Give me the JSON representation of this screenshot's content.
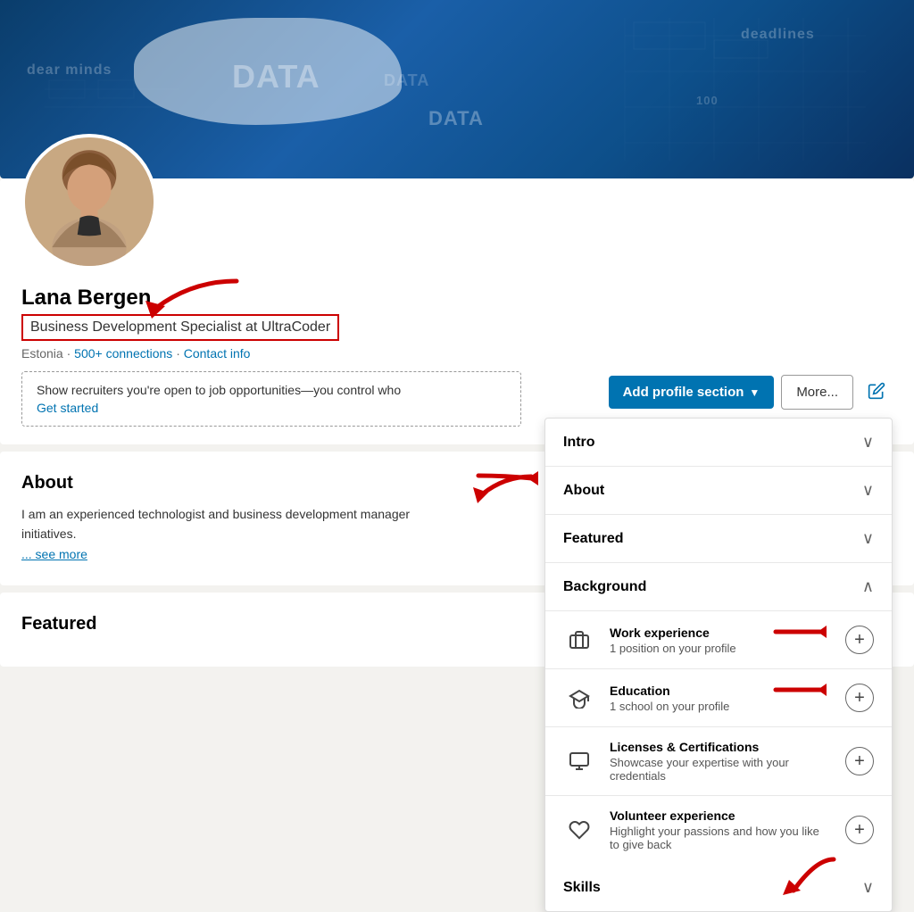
{
  "profile": {
    "name": "Lana Bergen",
    "title": "Business Development Specialist at UltraCoder",
    "location": "Estonia",
    "connections": "500+ connections",
    "contact_info": "Contact info",
    "open_to_work_text": "Show recruiters you're open to job opportunities—you control who",
    "get_started": "Get started",
    "about_heading": "About",
    "about_text": "I am an experienced technologist and business development manager",
    "about_text2": "initiatives.",
    "see_more": "... see more",
    "featured_heading": "Featured"
  },
  "toolbar": {
    "add_section_label": "Add profile section",
    "more_label": "More...",
    "edit_icon": "pencil"
  },
  "dropdown": {
    "intro_label": "Intro",
    "about_label": "About",
    "featured_label": "Featured",
    "background_label": "Background",
    "background_items": [
      {
        "icon": "briefcase",
        "title": "Work experience",
        "subtitle": "1 position on your profile"
      },
      {
        "icon": "school",
        "title": "Education",
        "subtitle": "1 school on your profile"
      },
      {
        "icon": "certificate",
        "title": "Licenses & Certifications",
        "subtitle": "Showcase your expertise with your credentials"
      },
      {
        "icon": "heart",
        "title": "Volunteer experience",
        "subtitle": "Highlight your passions and how you like to give back"
      }
    ],
    "skills_label": "Skills"
  },
  "banner": {
    "text1": "deadlines",
    "text2": "DATA",
    "text3": "DATA",
    "text4": "DATA",
    "text5": "deadlines",
    "text6": "dear minds"
  }
}
